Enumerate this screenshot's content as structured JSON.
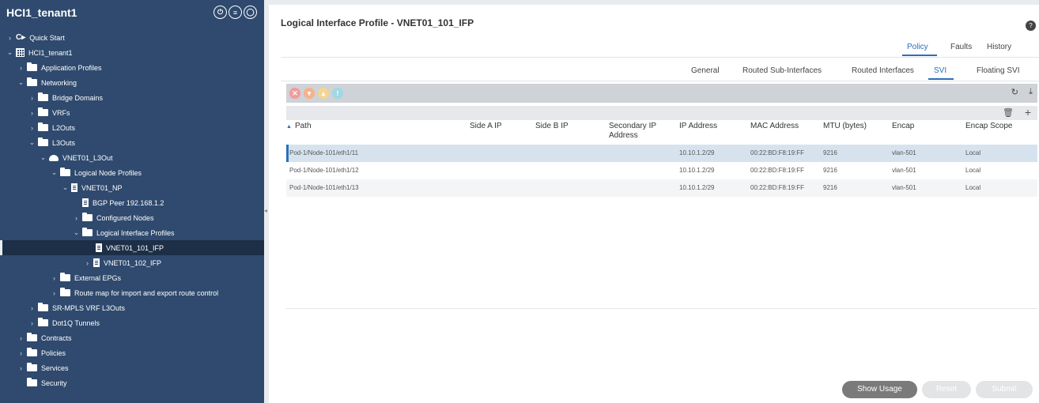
{
  "sidebar": {
    "title": "HCI1_tenant1",
    "header_icons": [
      "power-icon",
      "menu-list-icon",
      "refresh-circle-icon"
    ],
    "tree": [
      {
        "label": "Quick Start",
        "icon": "play-icon",
        "caret": "›"
      },
      {
        "label": "HCI1_tenant1",
        "icon": "grid-icon",
        "caret": "⌄"
      },
      {
        "label": "Application Profiles",
        "icon": "folder-icon",
        "caret": "›"
      },
      {
        "label": "Networking",
        "icon": "folder-icon",
        "caret": "⌄"
      },
      {
        "label": "Bridge Domains",
        "icon": "folder-icon",
        "caret": "›"
      },
      {
        "label": "VRFs",
        "icon": "folder-icon",
        "caret": "›"
      },
      {
        "label": "L2Outs",
        "icon": "folder-icon",
        "caret": "›"
      },
      {
        "label": "L3Outs",
        "icon": "folder-icon",
        "caret": "⌄"
      },
      {
        "label": "VNET01_L3Out",
        "icon": "cloud-icon",
        "caret": "⌄"
      },
      {
        "label": "Logical Node Profiles",
        "icon": "folder-icon",
        "caret": "⌄"
      },
      {
        "label": "VNET01_NP",
        "icon": "document-icon",
        "caret": "⌄"
      },
      {
        "label": "BGP Peer 192.168.1.2",
        "icon": "document-icon",
        "caret": ""
      },
      {
        "label": "Configured Nodes",
        "icon": "folder-icon",
        "caret": "›"
      },
      {
        "label": "Logical Interface Profiles",
        "icon": "folder-icon",
        "caret": "⌄"
      },
      {
        "label": "VNET01_101_IFP",
        "icon": "document-icon",
        "caret": ""
      },
      {
        "label": "VNET01_102_IFP",
        "icon": "document-icon",
        "caret": "›"
      },
      {
        "label": "External EPGs",
        "icon": "folder-icon",
        "caret": "›"
      },
      {
        "label": "Route map for import and export route control",
        "icon": "folder-icon",
        "caret": "›"
      },
      {
        "label": "SR-MPLS VRF L3Outs",
        "icon": "folder-icon",
        "caret": "›"
      },
      {
        "label": "Dot1Q Tunnels",
        "icon": "folder-icon",
        "caret": "›"
      },
      {
        "label": "Contracts",
        "icon": "folder-icon",
        "caret": "›"
      },
      {
        "label": "Policies",
        "icon": "folder-icon",
        "caret": "›"
      },
      {
        "label": "Services",
        "icon": "folder-icon",
        "caret": "›"
      },
      {
        "label": "Security",
        "icon": "folder-icon",
        "caret": ""
      }
    ]
  },
  "main": {
    "title": "Logical Interface Profile - VNET01_101_IFP",
    "top_tabs": [
      "Policy",
      "Faults",
      "History"
    ],
    "active_top_tab": "Policy",
    "sub_tabs": [
      "General",
      "Routed Sub-Interfaces",
      "Routed Interfaces",
      "SVI",
      "Floating SVI"
    ],
    "active_sub_tab": "SVI",
    "table": {
      "columns": [
        "Path",
        "Side A IP",
        "Side B IP",
        "Secondary IP Address",
        "IP Address",
        "MAC Address",
        "MTU (bytes)",
        "Encap",
        "Encap Scope"
      ],
      "sort_indicator": "▲",
      "rows": [
        [
          "Pod-1/Node-101/eth1/11",
          "",
          "",
          "",
          "10.10.1.2/29",
          "00:22:BD:F8:19:FF",
          "9216",
          "vlan-501",
          "Local"
        ],
        [
          "Pod-1/Node-101/eth1/12",
          "",
          "",
          "",
          "10.10.1.2/29",
          "00:22:BD:F8:19:FF",
          "9216",
          "vlan-501",
          "Local"
        ],
        [
          "Pod-1/Node-101/eth1/13",
          "",
          "",
          "",
          "10.10.1.2/29",
          "00:22:BD:F8:19:FF",
          "9216",
          "vlan-501",
          "Local"
        ]
      ]
    },
    "buttons": {
      "show_usage": "Show Usage",
      "reset": "Reset",
      "submit": "Submit"
    },
    "colors": {
      "accent": "#2a6ebb",
      "sidebar_bg": "#2f4a6e"
    }
  }
}
